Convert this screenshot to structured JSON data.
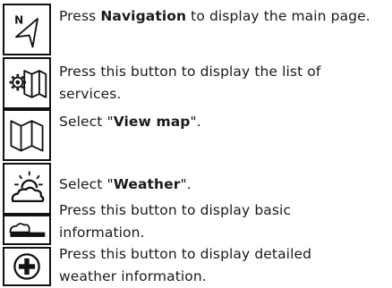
{
  "rows": [
    {
      "icon": "navigation-arrow-icon",
      "pre": "Press ",
      "bold": "Navigation",
      "post": " to display the main page."
    },
    {
      "icon": "services-map-settings-icon",
      "pre": "Press this button to display the list of services.",
      "bold": "",
      "post": ""
    },
    {
      "icon": "map-icon",
      "pre": "Select \"",
      "bold": "View map",
      "post": "\"."
    },
    {
      "icon": "weather-sun-cloud-icon",
      "pre": "Select \"",
      "bold": "Weather",
      "post": "\"."
    },
    {
      "icon": "info-panel-toggle-icon",
      "pre": "Press this button to display basic information.",
      "bold": "",
      "post": ""
    },
    {
      "icon": "plus-circle-icon",
      "pre": "Press this button to display detailed weather information.",
      "bold": "",
      "post": ""
    }
  ],
  "nav_icon_letter": "N"
}
